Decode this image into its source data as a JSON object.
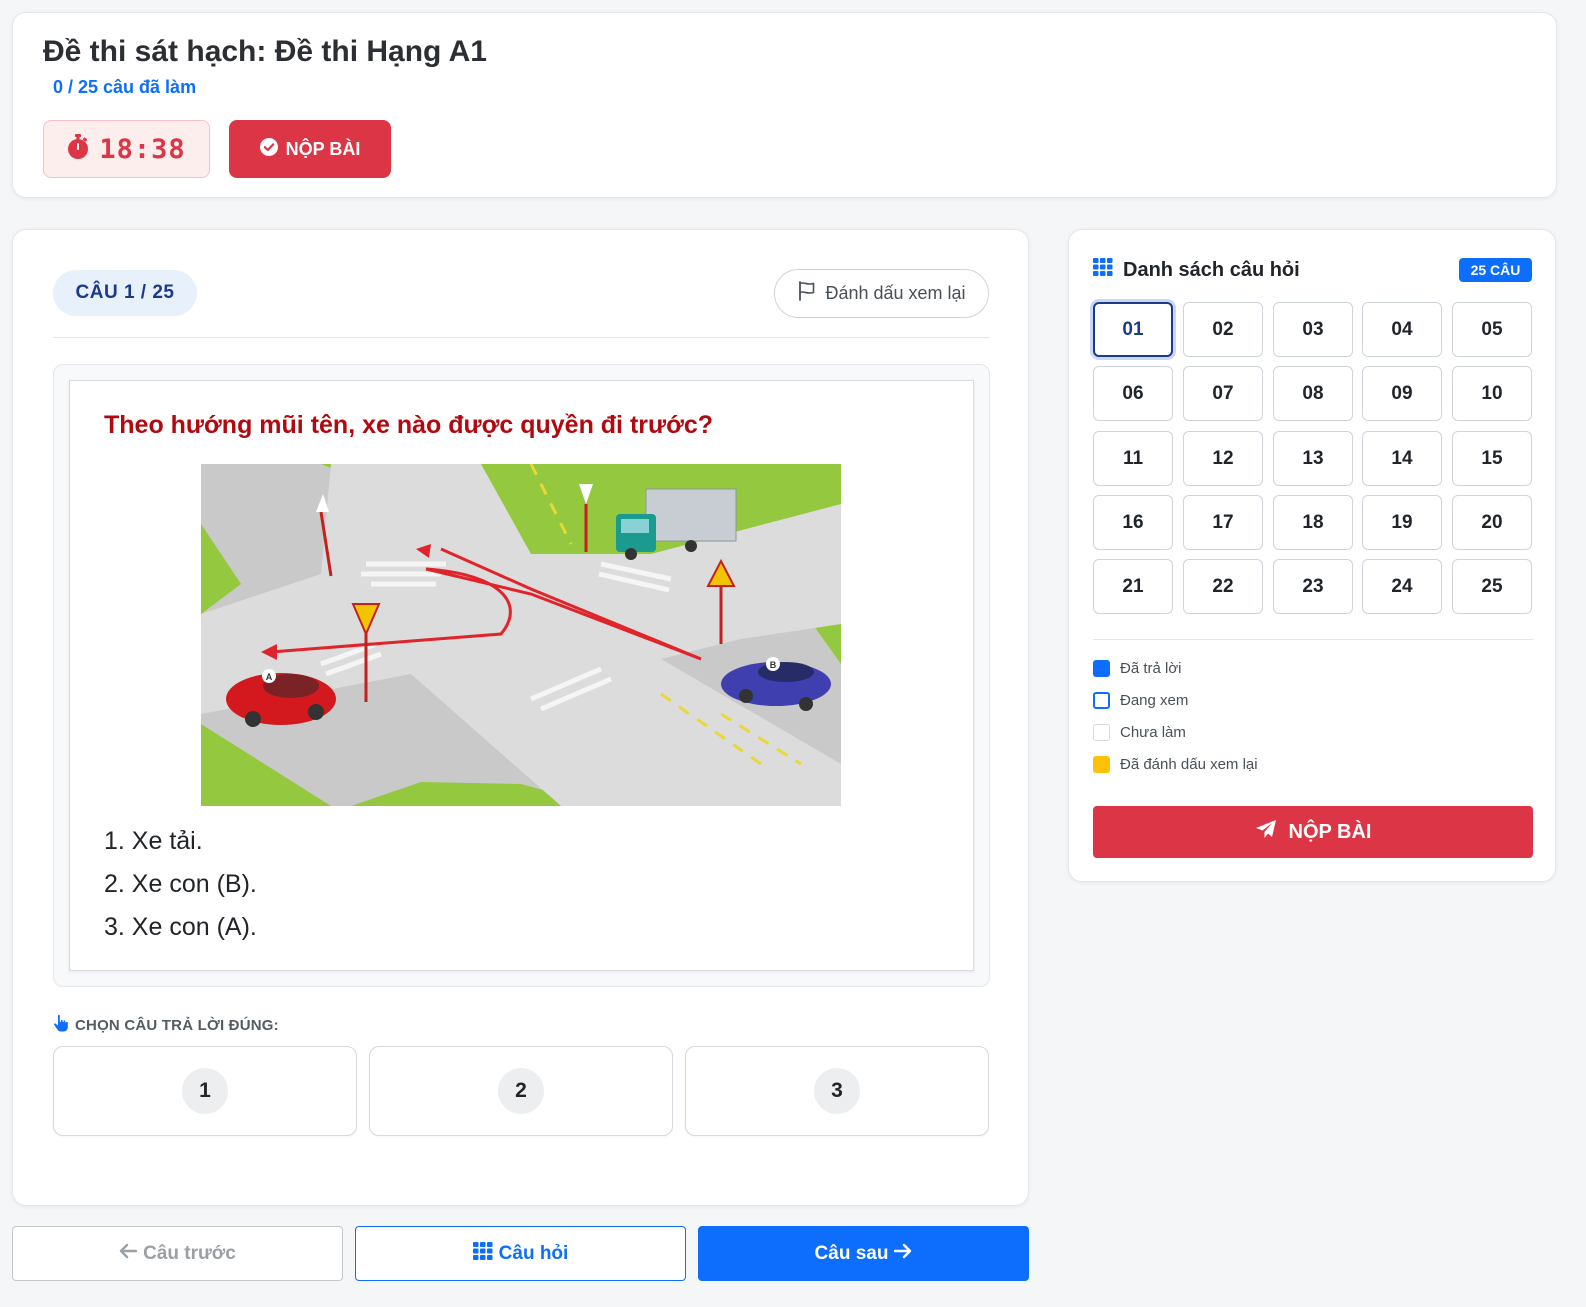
{
  "header": {
    "exam_title": "Đề thi sát hạch: Đề thi Hạng A1",
    "progress_text": "0 / 25 câu đã làm",
    "timer_icon": "stopwatch-icon",
    "timer": "18:38",
    "submit_label": "NỘP BÀI",
    "submit_icon": "check-circle-icon"
  },
  "question": {
    "counter": "CÂU 1 / 25",
    "mark_review_label": "Đánh dấu xem lại",
    "mark_review_icon": "flag-icon",
    "text": "Theo hướng mũi tên, xe nào được quyền đi trước?",
    "options": [
      "1. Xe tải.",
      "2. Xe con (B).",
      "3. Xe con (A)."
    ],
    "choose_label": "CHỌN CÂU TRẢ LỜI ĐÚNG:",
    "choose_icon": "hand-pointer-icon",
    "answers": [
      "1",
      "2",
      "3"
    ],
    "image_labels": {
      "car_a": "A",
      "car_b": "B"
    }
  },
  "sidebar": {
    "title": "Danh sách câu hỏi",
    "title_icon": "grid-icon",
    "badge": "25 CÂU",
    "current": "01",
    "questions": [
      "01",
      "02",
      "03",
      "04",
      "05",
      "06",
      "07",
      "08",
      "09",
      "10",
      "11",
      "12",
      "13",
      "14",
      "15",
      "16",
      "17",
      "18",
      "19",
      "20",
      "21",
      "22",
      "23",
      "24",
      "25"
    ],
    "legend": [
      {
        "label": "Đã trả lời",
        "color": "#0d6efd",
        "style": "filled"
      },
      {
        "label": "Đang xem",
        "color": "#0d6efd",
        "style": "outline"
      },
      {
        "label": "Chưa làm",
        "color": "#d6d9dd",
        "style": "outline"
      },
      {
        "label": "Đã đánh dấu xem lại",
        "color": "#ffc107",
        "style": "filled"
      }
    ],
    "submit_label": "NỘP BÀI",
    "submit_icon": "paper-plane-icon"
  },
  "nav": {
    "prev_label": "Câu trước",
    "prev_icon": "arrow-left-icon",
    "list_label": "Câu hỏi",
    "list_icon": "grid-icon",
    "next_label": "Câu sau",
    "next_icon": "arrow-right-icon"
  },
  "colors": {
    "primary": "#0d6efd",
    "danger": "#dc3545",
    "question_text": "#b00a10",
    "counter_text": "#1a3a8a"
  }
}
